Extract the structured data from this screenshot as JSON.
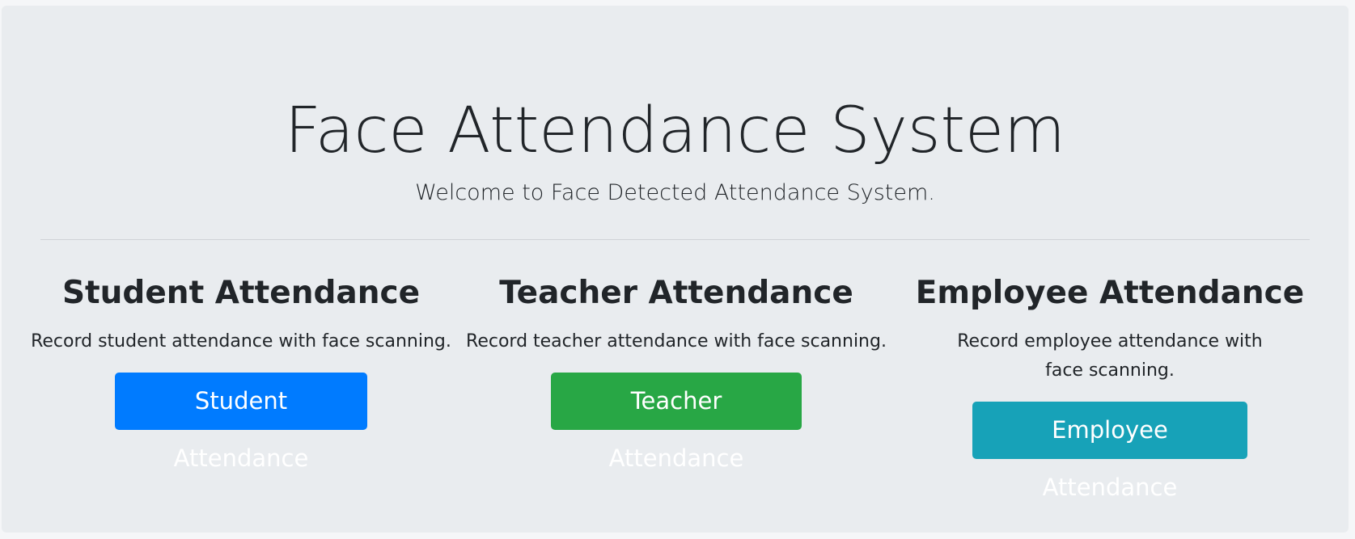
{
  "header": {
    "title": "Face Attendance System",
    "subtitle": "Welcome to Face Detected Attendance System."
  },
  "sections": [
    {
      "heading": "Student Attendance",
      "description": "Record student attendance with face scanning.",
      "button_label": "Student Attendance",
      "button_color": "#007bff"
    },
    {
      "heading": "Teacher Attendance",
      "description": "Record teacher attendance with face scanning.",
      "button_label": "Teacher Attendance",
      "button_color": "#28a745"
    },
    {
      "heading": "Employee Attendance",
      "description": "Record employee attendance with face scanning.",
      "button_label": "Employee Attendance",
      "button_color": "#17a2b8"
    }
  ],
  "colors": {
    "background": "#e9ecef",
    "text": "#212529"
  }
}
